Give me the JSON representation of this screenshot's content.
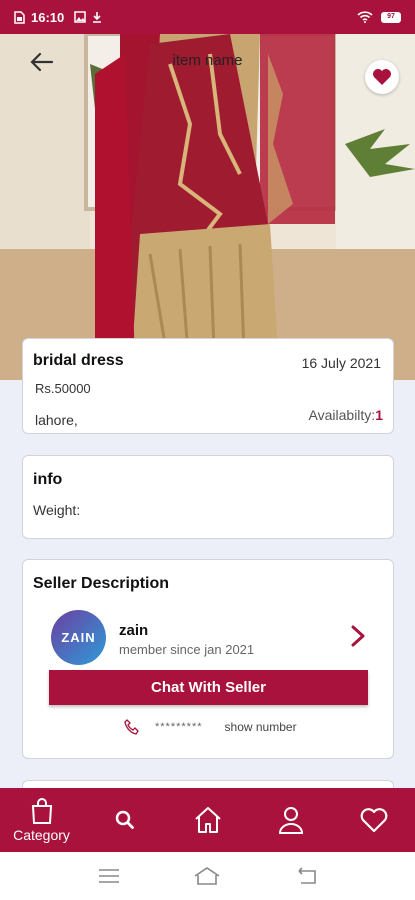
{
  "status_bar": {
    "time": "16:10",
    "battery": "97"
  },
  "header": {
    "title": "item name"
  },
  "item": {
    "title": "bridal dress",
    "date": "16 July 2021",
    "price": "Rs.50000",
    "location": "lahore,",
    "availability_label": "Availabilty:",
    "availability_value": "1"
  },
  "info": {
    "title": "info",
    "weight_label": "Weight:"
  },
  "seller": {
    "section_title": "Seller Description",
    "avatar_text": "ZAIN",
    "name": "zain",
    "member_since": "member since jan 2021",
    "chat_button": "Chat With Seller",
    "phone_masked": "*********",
    "show_number": "show number"
  },
  "bottom_nav": {
    "category_label": "Category"
  },
  "colors": {
    "brand": "#a8123c",
    "background": "#eceef8"
  }
}
